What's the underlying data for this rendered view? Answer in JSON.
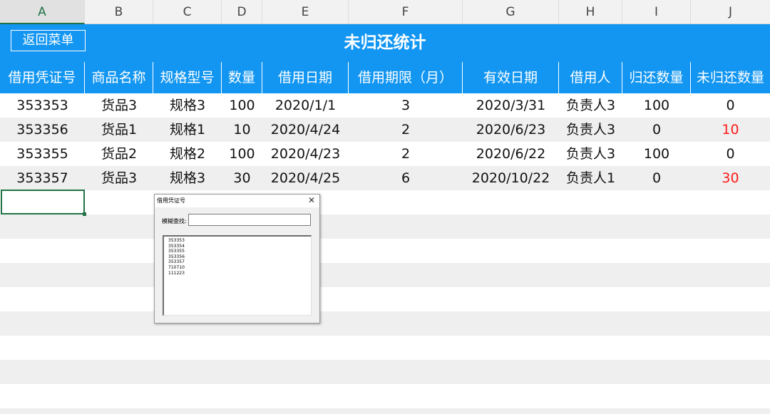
{
  "column_headers": [
    "A",
    "B",
    "C",
    "D",
    "E",
    "F",
    "G",
    "H",
    "I",
    "J"
  ],
  "active_column": "A",
  "back_button_label": "返回菜单",
  "sheet_title": "未归还统计",
  "table": {
    "headers": [
      "借用凭证号",
      "商品名称",
      "规格型号",
      "数量",
      "借用日期",
      "借用期限（月）",
      "有效日期",
      "借用人",
      "归还数量",
      "未归还数量"
    ],
    "rows": [
      [
        "353353",
        "货品3",
        "规格3",
        "100",
        "2020/1/1",
        "3",
        "2020/3/31",
        "负责人3",
        "100",
        "0"
      ],
      [
        "353356",
        "货品1",
        "规格1",
        "10",
        "2020/4/24",
        "2",
        "2020/6/23",
        "负责人3",
        "0",
        "10"
      ],
      [
        "353355",
        "货品2",
        "规格2",
        "100",
        "2020/4/23",
        "2",
        "2020/6/22",
        "负责人3",
        "100",
        "0"
      ],
      [
        "353357",
        "货品3",
        "规格3",
        "30",
        "2020/4/25",
        "6",
        "2020/10/22",
        "负责人1",
        "0",
        "30"
      ]
    ],
    "highlight_color": "#ff1a1a"
  },
  "colors": {
    "header_blue": "#1296f2",
    "selection_green": "#217346"
  },
  "dialog": {
    "title": "借用凭证号",
    "close_icon": "close-icon",
    "search_label": "模糊查找:",
    "search_value": "",
    "list_items": [
      "353353",
      "353354",
      "353355",
      "353356",
      "353357",
      "710710",
      "111223"
    ]
  }
}
